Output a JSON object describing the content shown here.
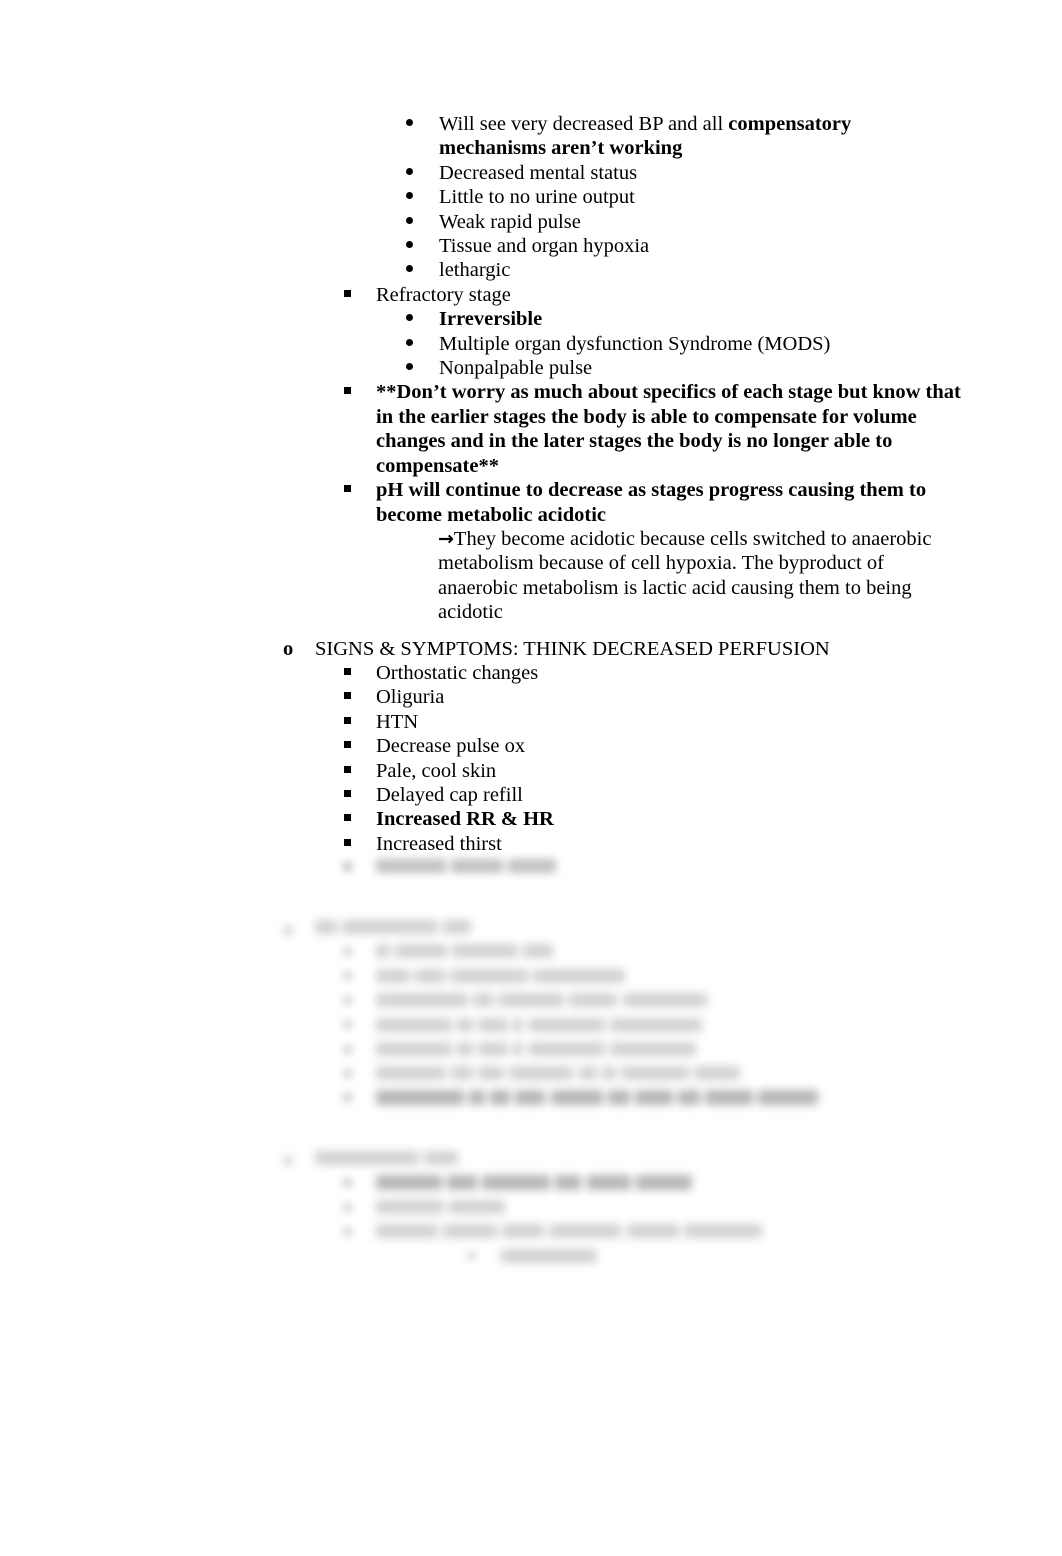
{
  "document": {
    "type": "study-notes-outline",
    "topic": "Shock stages and signs & symptoms",
    "page_background": "#ffffff",
    "text_color": "#000000"
  },
  "markers": {
    "square": "▪",
    "dot": "•",
    "circle_letter": "o",
    "arrow": "→"
  },
  "outline": {
    "hypovolemic_stage_signs": [
      {
        "level": "dot",
        "segments": [
          {
            "text": "Will see very decreased BP and all ",
            "bold": false
          },
          {
            "text": "compensatory mechanisms aren’t working",
            "bold": true
          }
        ],
        "plain": "Will see very decreased BP and all compensatory mechanisms aren’t working"
      },
      {
        "level": "dot",
        "plain": "Decreased mental status",
        "bold": false
      },
      {
        "level": "dot",
        "plain": "Little to no urine output",
        "bold": false
      },
      {
        "level": "dot",
        "plain": "Weak rapid pulse",
        "bold": false
      },
      {
        "level": "dot",
        "plain": "Tissue and organ hypoxia",
        "bold": false
      },
      {
        "level": "dot",
        "plain": "lethargic",
        "bold": false
      }
    ],
    "refractory_stage": {
      "heading": "Refractory stage",
      "items": [
        {
          "plain": "Irreversible",
          "bold": true
        },
        {
          "plain": "Multiple organ dysfunction Syndrome (MODS)",
          "bold": false
        },
        {
          "plain": "Nonpalpable pulse",
          "bold": false
        }
      ]
    },
    "notes": [
      {
        "level": "square",
        "bold": true,
        "plain": "**Don’t worry as much about specifics of each stage but know that in the earlier stages the body is able to compensate for volume changes and in the later stages the body is no longer able to compensate**"
      },
      {
        "level": "square",
        "bold": true,
        "plain": "pH will continue to decrease as stages progress causing them to become metabolic acidotic"
      }
    ],
    "acidosis_explanation": {
      "level": "arrow",
      "plain": "They become acidotic because cells switched to anaerobic metabolism because of cell hypoxia. The byproduct of anaerobic metabolism is lactic acid causing them to being acidotic"
    },
    "signs_symptoms": {
      "heading": "SIGNS & SYMPTOMS: THINK DECREASED PERFUSION",
      "items": [
        {
          "plain": "Orthostatic changes",
          "bold": false
        },
        {
          "plain": "Oliguria",
          "bold": false
        },
        {
          "plain": "HTN",
          "bold": false
        },
        {
          "plain": "Decrease pulse ox",
          "bold": false
        },
        {
          "plain": "Pale, cool skin",
          "bold": false
        },
        {
          "plain": "Delayed cap refill",
          "bold": false
        },
        {
          "plain": "Increased RR & HR",
          "bold": true
        },
        {
          "plain": "Increased thirst",
          "bold": false
        }
      ]
    },
    "obscured": {
      "note": "Remaining content is blurred in the screenshot and is not legible.",
      "trailing_item_of_signs": {
        "widths": [
          70,
          52,
          48
        ]
      },
      "sections": [
        {
          "heading_widths": [
            22,
            96,
            28
          ],
          "items": [
            {
              "widths": [
                14,
                52,
                66,
                30
              ],
              "bold": false
            },
            {
              "widths": [
                34,
                30,
                78,
                92
              ],
              "bold": false
            },
            {
              "widths": [
                92,
                20,
                66,
                48,
                84
              ],
              "bold": false
            },
            {
              "widths": [
                76,
                16,
                30,
                10,
                76,
                92
              ],
              "bold": false
            },
            {
              "widths": [
                76,
                16,
                30,
                10,
                76,
                86
              ],
              "bold": false
            },
            {
              "widths": [
                70,
                22,
                26,
                64,
                18,
                14,
                68,
                46
              ],
              "bold": false
            },
            {
              "widths": [
                88,
                16,
                20,
                30,
                52,
                22,
                38,
                22,
                48,
                60
              ],
              "bold": true
            }
          ]
        },
        {
          "heading_widths": [
            104,
            34
          ],
          "items": [
            {
              "widths": [
                66,
                30,
                68,
                26,
                44,
                56
              ],
              "bold": true
            },
            {
              "widths": [
                68,
                56
              ],
              "bold": false
            },
            {
              "widths": [
                62,
                54,
                42,
                72,
                52,
                78
              ],
              "bold": false
            }
          ],
          "subitem": {
            "widths": [
              96
            ],
            "bold": false
          }
        }
      ]
    }
  }
}
